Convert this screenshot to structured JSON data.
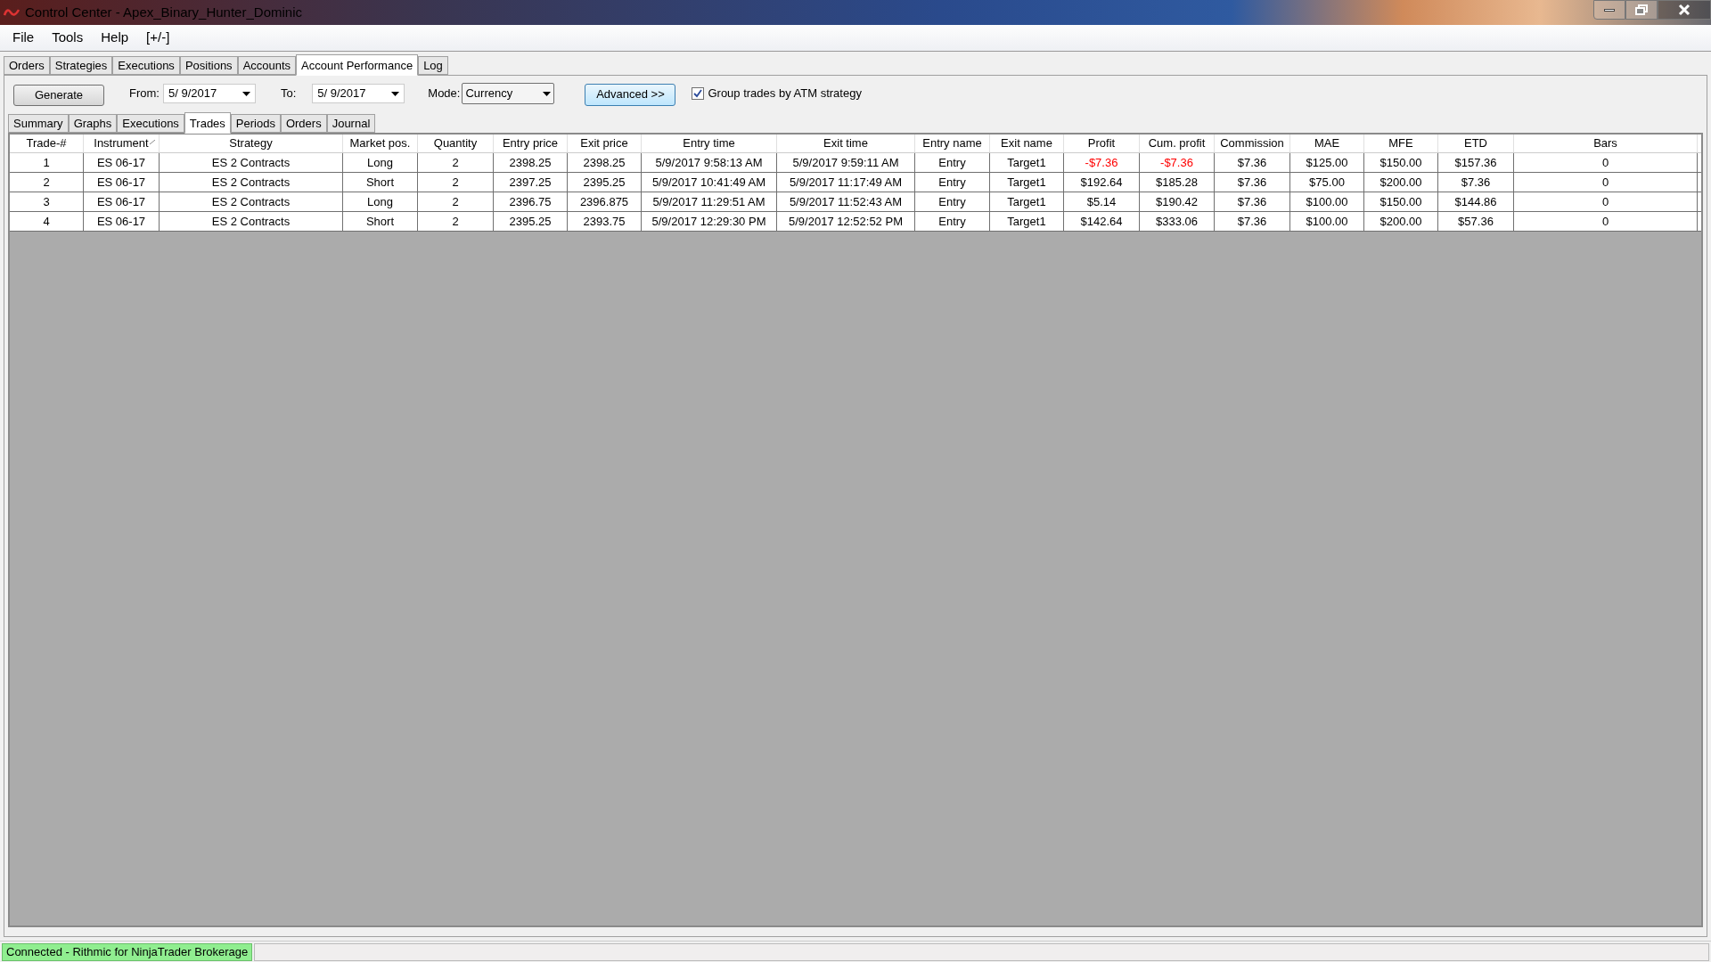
{
  "window": {
    "title": "Control Center - Apex_Binary_Hunter_Dominic"
  },
  "menu": [
    "File",
    "Tools",
    "Help",
    "[+/-]"
  ],
  "tabs": [
    {
      "label": "Orders",
      "selected": false
    },
    {
      "label": "Strategies",
      "selected": false
    },
    {
      "label": "Executions",
      "selected": false
    },
    {
      "label": "Positions",
      "selected": false
    },
    {
      "label": "Accounts",
      "selected": false
    },
    {
      "label": "Account Performance",
      "selected": true
    },
    {
      "label": "Log",
      "selected": false
    }
  ],
  "toolbar": {
    "generate": "Generate",
    "from_label": "From:",
    "from_value": "5/  9/2017",
    "to_label": "To:",
    "to_value": "5/  9/2017",
    "mode_label": "Mode:",
    "mode_value": "Currency",
    "advanced": "Advanced >>",
    "group_label": "Group trades by ATM strategy",
    "group_checked": true
  },
  "subtabs": [
    {
      "label": "Summary",
      "selected": false
    },
    {
      "label": "Graphs",
      "selected": false
    },
    {
      "label": "Executions",
      "selected": false
    },
    {
      "label": "Trades",
      "selected": true
    },
    {
      "label": "Periods",
      "selected": false
    },
    {
      "label": "Orders",
      "selected": false
    },
    {
      "label": "Journal",
      "selected": false
    }
  ],
  "table": {
    "columns": [
      {
        "label": "Trade-#",
        "sorted": false
      },
      {
        "label": "Instrument",
        "sorted": true
      },
      {
        "label": "Strategy",
        "sorted": false
      },
      {
        "label": "Market pos.",
        "sorted": false
      },
      {
        "label": "Quantity",
        "sorted": false
      },
      {
        "label": "Entry price",
        "sorted": false
      },
      {
        "label": "Exit price",
        "sorted": false
      },
      {
        "label": "Entry time",
        "sorted": false
      },
      {
        "label": "Exit time",
        "sorted": false
      },
      {
        "label": "Entry name",
        "sorted": false
      },
      {
        "label": "Exit name",
        "sorted": false
      },
      {
        "label": "Profit",
        "sorted": false
      },
      {
        "label": "Cum. profit",
        "sorted": false
      },
      {
        "label": "Commission",
        "sorted": false
      },
      {
        "label": "MAE",
        "sorted": false
      },
      {
        "label": "MFE",
        "sorted": false
      },
      {
        "label": "ETD",
        "sorted": false
      },
      {
        "label": "Bars",
        "sorted": false
      }
    ],
    "rows": [
      {
        "cells": [
          "1",
          "ES 06-17",
          "ES 2 Contracts",
          "Long",
          "2",
          "2398.25",
          "2398.25",
          "5/9/2017 9:58:13 AM",
          "5/9/2017 9:59:11 AM",
          "Entry",
          "Target1",
          "-$7.36",
          "-$7.36",
          "$7.36",
          "$125.00",
          "$150.00",
          "$157.36",
          "0"
        ],
        "profit_negative": true,
        "cum_profit_negative": true
      },
      {
        "cells": [
          "2",
          "ES 06-17",
          "ES 2 Contracts",
          "Short",
          "2",
          "2397.25",
          "2395.25",
          "5/9/2017 10:41:49 AM",
          "5/9/2017 11:17:49 AM",
          "Entry",
          "Target1",
          "$192.64",
          "$185.28",
          "$7.36",
          "$75.00",
          "$200.00",
          "$7.36",
          "0"
        ],
        "profit_negative": false,
        "cum_profit_negative": false
      },
      {
        "cells": [
          "3",
          "ES 06-17",
          "ES 2 Contracts",
          "Long",
          "2",
          "2396.75",
          "2396.875",
          "5/9/2017 11:29:51 AM",
          "5/9/2017 11:52:43 AM",
          "Entry",
          "Target1",
          "$5.14",
          "$190.42",
          "$7.36",
          "$100.00",
          "$150.00",
          "$144.86",
          "0"
        ],
        "profit_negative": false,
        "cum_profit_negative": false
      },
      {
        "cells": [
          "4",
          "ES 06-17",
          "ES 2 Contracts",
          "Short",
          "2",
          "2395.25",
          "2393.75",
          "5/9/2017 12:29:30 PM",
          "5/9/2017 12:52:52 PM",
          "Entry",
          "Target1",
          "$142.64",
          "$333.06",
          "$7.36",
          "$100.00",
          "$200.00",
          "$57.36",
          "0"
        ],
        "profit_negative": false,
        "cum_profit_negative": false
      }
    ]
  },
  "status_bar": {
    "text": "Connected - Rithmic for NinjaTrader Brokerage"
  }
}
